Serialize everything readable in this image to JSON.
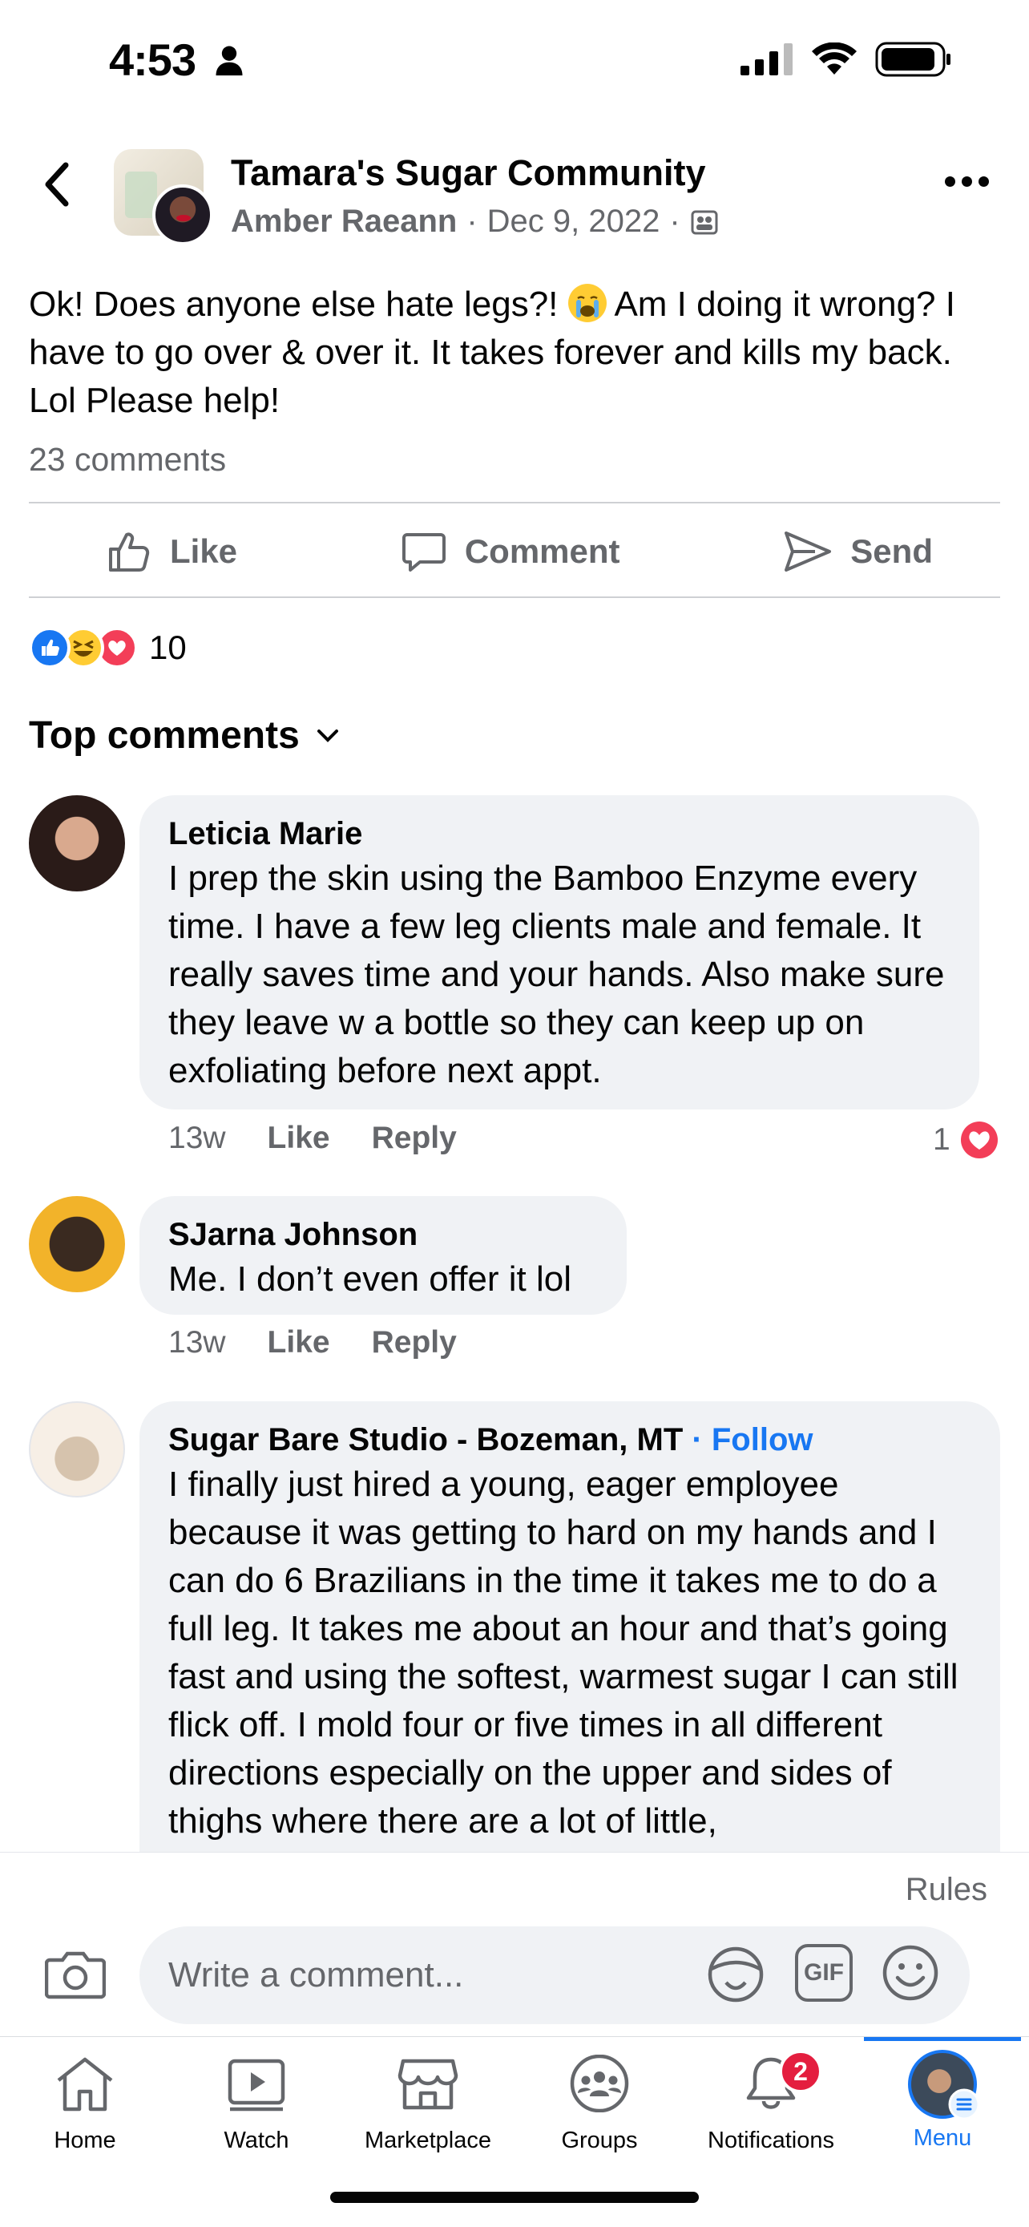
{
  "status_bar": {
    "time": "4:53"
  },
  "header": {
    "group_name": "Tamara's Sugar Community",
    "author": "Amber Raeann",
    "date": "Dec 9, 2022",
    "separator": "·"
  },
  "post": {
    "text_part1": "Ok! Does anyone else hate legs?! ",
    "text_part2": " Am I doing it wrong? I have to go over & over it. It takes forever and kills my back. Lol Please help!",
    "comments_count": "23 comments"
  },
  "actions": {
    "like": "Like",
    "comment": "Comment",
    "send": "Send"
  },
  "reactions": {
    "count": "10"
  },
  "top_comments_label": "Top comments",
  "comments": [
    {
      "name": "Leticia Marie",
      "text": "I prep the skin using the Bamboo Enzyme every time. I have a few leg clients male and female. It really saves time and your hands. Also make sure they leave w a bottle so they can keep up on exfoliating before next appt.",
      "time": "13w",
      "like": "Like",
      "reply": "Reply",
      "reaction_count": "1"
    },
    {
      "name": "SJarna Johnson",
      "text": "Me. I don’t even offer it lol",
      "time": "13w",
      "like": "Like",
      "reply": "Reply"
    },
    {
      "name": "Sugar Bare Studio - Bozeman, MT",
      "follow": "Follow",
      "text": "I finally just hired a young, eager employee because it was getting to hard on my hands and I can do 6 Brazilians in the time it takes me to do a full leg. It takes me about an hour and that’s going fast and using the softest, warmest sugar I can still flick off. I mold four or five times in all different directions especially on the upper and sides of  thighs where there are a lot of little,"
    }
  ],
  "composer": {
    "rules": "Rules",
    "placeholder": "Write a comment...",
    "gif": "GIF"
  },
  "tabs": [
    {
      "label": "Home"
    },
    {
      "label": "Watch"
    },
    {
      "label": "Marketplace"
    },
    {
      "label": "Groups"
    },
    {
      "label": "Notifications",
      "badge": "2"
    },
    {
      "label": "Menu"
    }
  ],
  "colors": {
    "accent": "#1877f2",
    "muted": "#65676b",
    "bubble": "#f0f2f5",
    "badge": "#e41e3f"
  }
}
